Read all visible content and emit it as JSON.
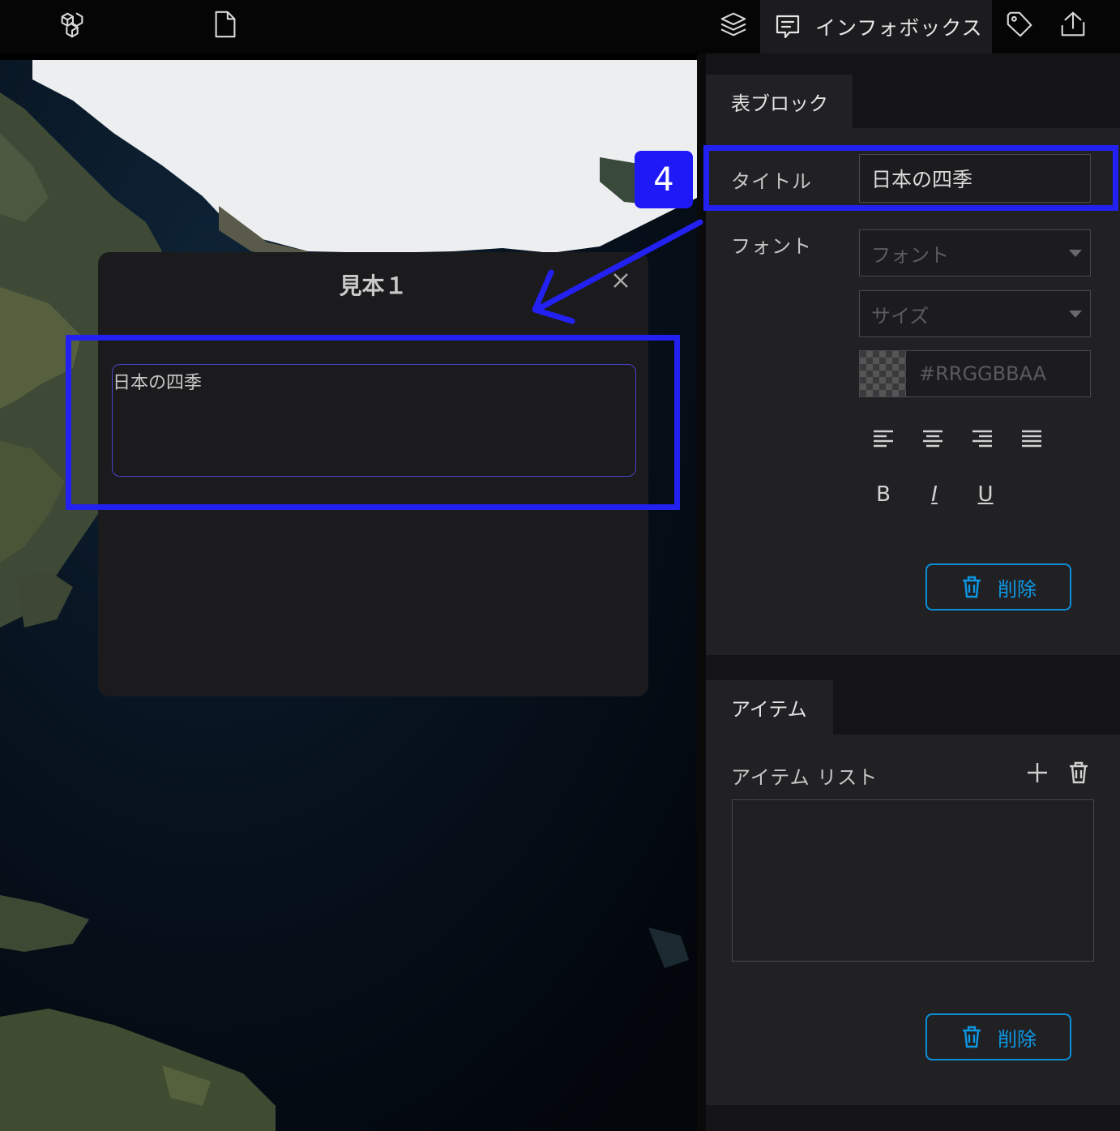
{
  "topbar": {
    "icons": [
      "cube-cluster-icon",
      "file-icon",
      "layers-icon",
      "tag-icon",
      "export-icon"
    ],
    "active_tab": {
      "icon": "infobox-icon",
      "label": "インフォボックス"
    }
  },
  "popup": {
    "title": "見本１",
    "content_title": "日本の四季",
    "close_icon": "close-icon"
  },
  "annotation": {
    "step_number": "4",
    "color": "#2320f2"
  },
  "panel": {
    "table_block": {
      "tab_label": "表ブロック",
      "title_label": "タイトル",
      "title_value": "日本の四季",
      "font_label": "フォント",
      "font_placeholder": "フォント",
      "size_placeholder": "サイズ",
      "color_placeholder": "#RRGGBBAA",
      "align_buttons": [
        "align-left-icon",
        "align-center-icon",
        "align-right-icon",
        "align-justify-icon"
      ],
      "format_buttons": [
        "B",
        "I",
        "U"
      ],
      "delete_label": "削除"
    },
    "items": {
      "tab_label": "アイテム",
      "list_label": "アイテム リスト",
      "delete_label": "削除"
    }
  },
  "colors": {
    "accent_blue": "#0d98e4",
    "annotation_blue": "#2320f2",
    "panel_bg": "#212124"
  }
}
